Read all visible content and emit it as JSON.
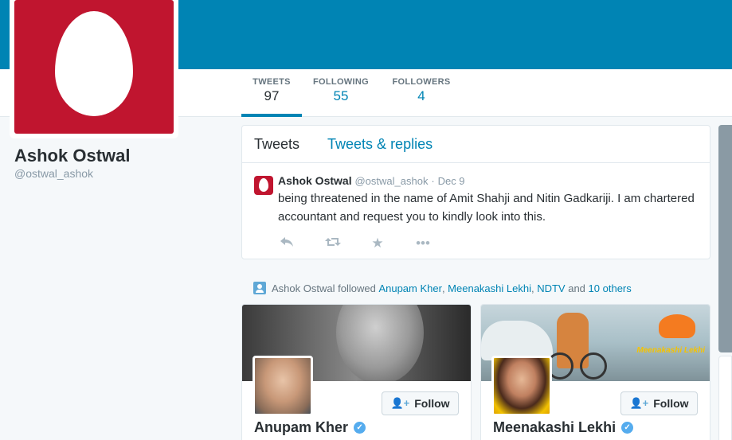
{
  "profile": {
    "name": "Ashok Ostwal",
    "handle": "@ostwal_ashok",
    "avatar_color": "#c0152f"
  },
  "nav": {
    "stats": [
      {
        "label": "TWEETS",
        "value": "97",
        "active": true
      },
      {
        "label": "FOLLOWING",
        "value": "55",
        "active": false
      },
      {
        "label": "FOLLOWERS",
        "value": "4",
        "active": false
      }
    ]
  },
  "timeline": {
    "tabs": [
      {
        "label": "Tweets"
      },
      {
        "label": "Tweets & replies"
      }
    ],
    "tweet": {
      "author": "Ashok Ostwal",
      "handle": "@ostwal_ashok",
      "date": "Dec 9",
      "text": "being threatened in the name of Amit Shahji and Nitin Gadkariji. I am chartered accountant and request you to kindly look into this.",
      "actions": [
        "reply-icon",
        "retweet-icon",
        "favorite-icon",
        "more-icon"
      ]
    }
  },
  "activity": {
    "actor": "Ashok Ostwal",
    "verb": "followed",
    "names": [
      "Anupam Kher",
      "Meenakashi Lekhi",
      "NDTV"
    ],
    "and_text": "and",
    "others": "10 others"
  },
  "user_cards": [
    {
      "name": "Anupam Kher",
      "follow_label": "Follow",
      "verified": true
    },
    {
      "name": "Meenakashi Lekhi",
      "follow_label": "Follow",
      "verified": true,
      "banner_text": "Meenakashi Lekhi"
    }
  ],
  "colors": {
    "accent": "#0084b4",
    "background": "#f5f8fa"
  }
}
